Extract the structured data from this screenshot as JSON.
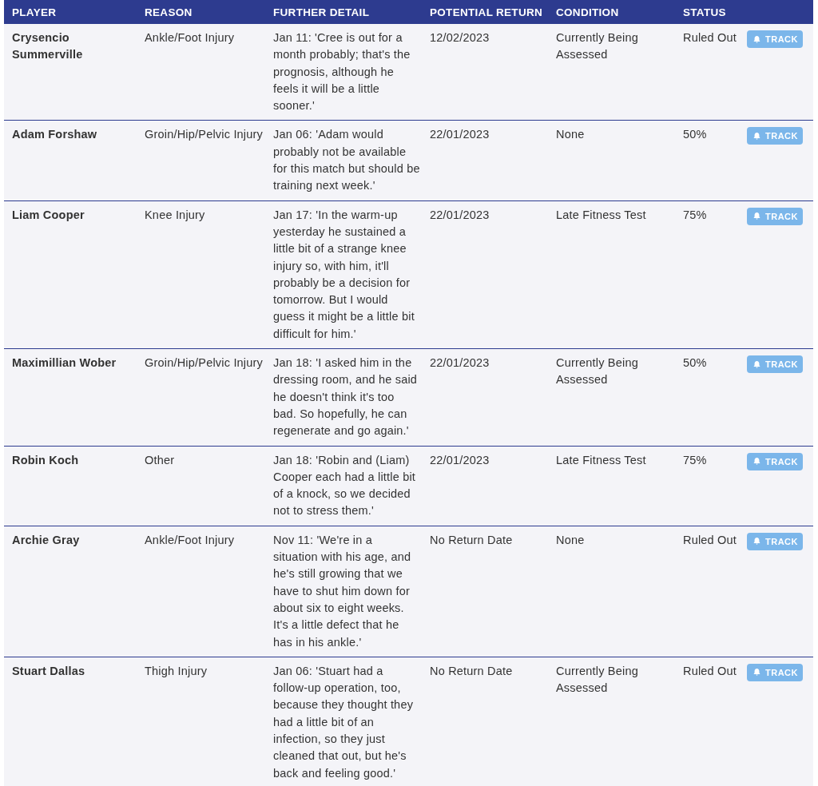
{
  "table": {
    "columns": [
      "PLAYER",
      "REASON",
      "FURTHER DETAIL",
      "POTENTIAL RETURN",
      "CONDITION",
      "STATUS"
    ],
    "rows": [
      {
        "player": "Crysencio Summerville",
        "reason": "Ankle/Foot Injury",
        "detail": "Jan 11: 'Cree is out for a month probably; that's the prognosis, although he feels it will be a little sooner.'",
        "return": "12/02/2023",
        "condition": "Currently Being Assessed",
        "status": "Ruled Out",
        "action": "TRACK"
      },
      {
        "player": "Adam Forshaw",
        "reason": "Groin/Hip/Pelvic Injury",
        "detail": "Jan 06: 'Adam would probably not be available for this match but should be training next week.'",
        "return": "22/01/2023",
        "condition": "None",
        "status": "50%",
        "action": "TRACK"
      },
      {
        "player": "Liam Cooper",
        "reason": "Knee Injury",
        "detail": "Jan 17: 'In the warm-up yesterday he sustained a little bit of a strange knee injury so, with him, it'll probably be a decision for tomorrow. But I would guess it might be a little bit difficult for him.'",
        "return": "22/01/2023",
        "condition": "Late Fitness Test",
        "status": "75%",
        "action": "TRACK"
      },
      {
        "player": "Maximillian Wober",
        "reason": "Groin/Hip/Pelvic Injury",
        "detail": "Jan 18: 'I asked him in the dressing room, and he said he doesn't think it's too bad. So hopefully, he can regenerate and go again.'",
        "return": "22/01/2023",
        "condition": "Currently Being Assessed",
        "status": "50%",
        "action": "TRACK"
      },
      {
        "player": "Robin Koch",
        "reason": "Other",
        "detail": "Jan 18: 'Robin and (Liam) Cooper each had a little bit of a knock, so we decided not to stress them.'",
        "return": "22/01/2023",
        "condition": "Late Fitness Test",
        "status": "75%",
        "action": "TRACK"
      },
      {
        "player": "Archie Gray",
        "reason": "Ankle/Foot Injury",
        "detail": "Nov 11: 'We're in a situation with his age, and he's still growing that we have to shut him down for about six to eight weeks. It's a little defect that he has in his ankle.'",
        "return": "No Return Date",
        "condition": "None",
        "status": "Ruled Out",
        "action": "TRACK"
      },
      {
        "player": "Stuart Dallas",
        "reason": "Thigh Injury",
        "detail": "Jan 06: 'Stuart had a follow-up operation, too, because they thought they had a little bit of an infection, so they just cleaned that out, but he's back and feeling good.'",
        "return": "No Return Date",
        "condition": "Currently Being Assessed",
        "status": "Ruled Out",
        "action": "TRACK"
      }
    ]
  }
}
